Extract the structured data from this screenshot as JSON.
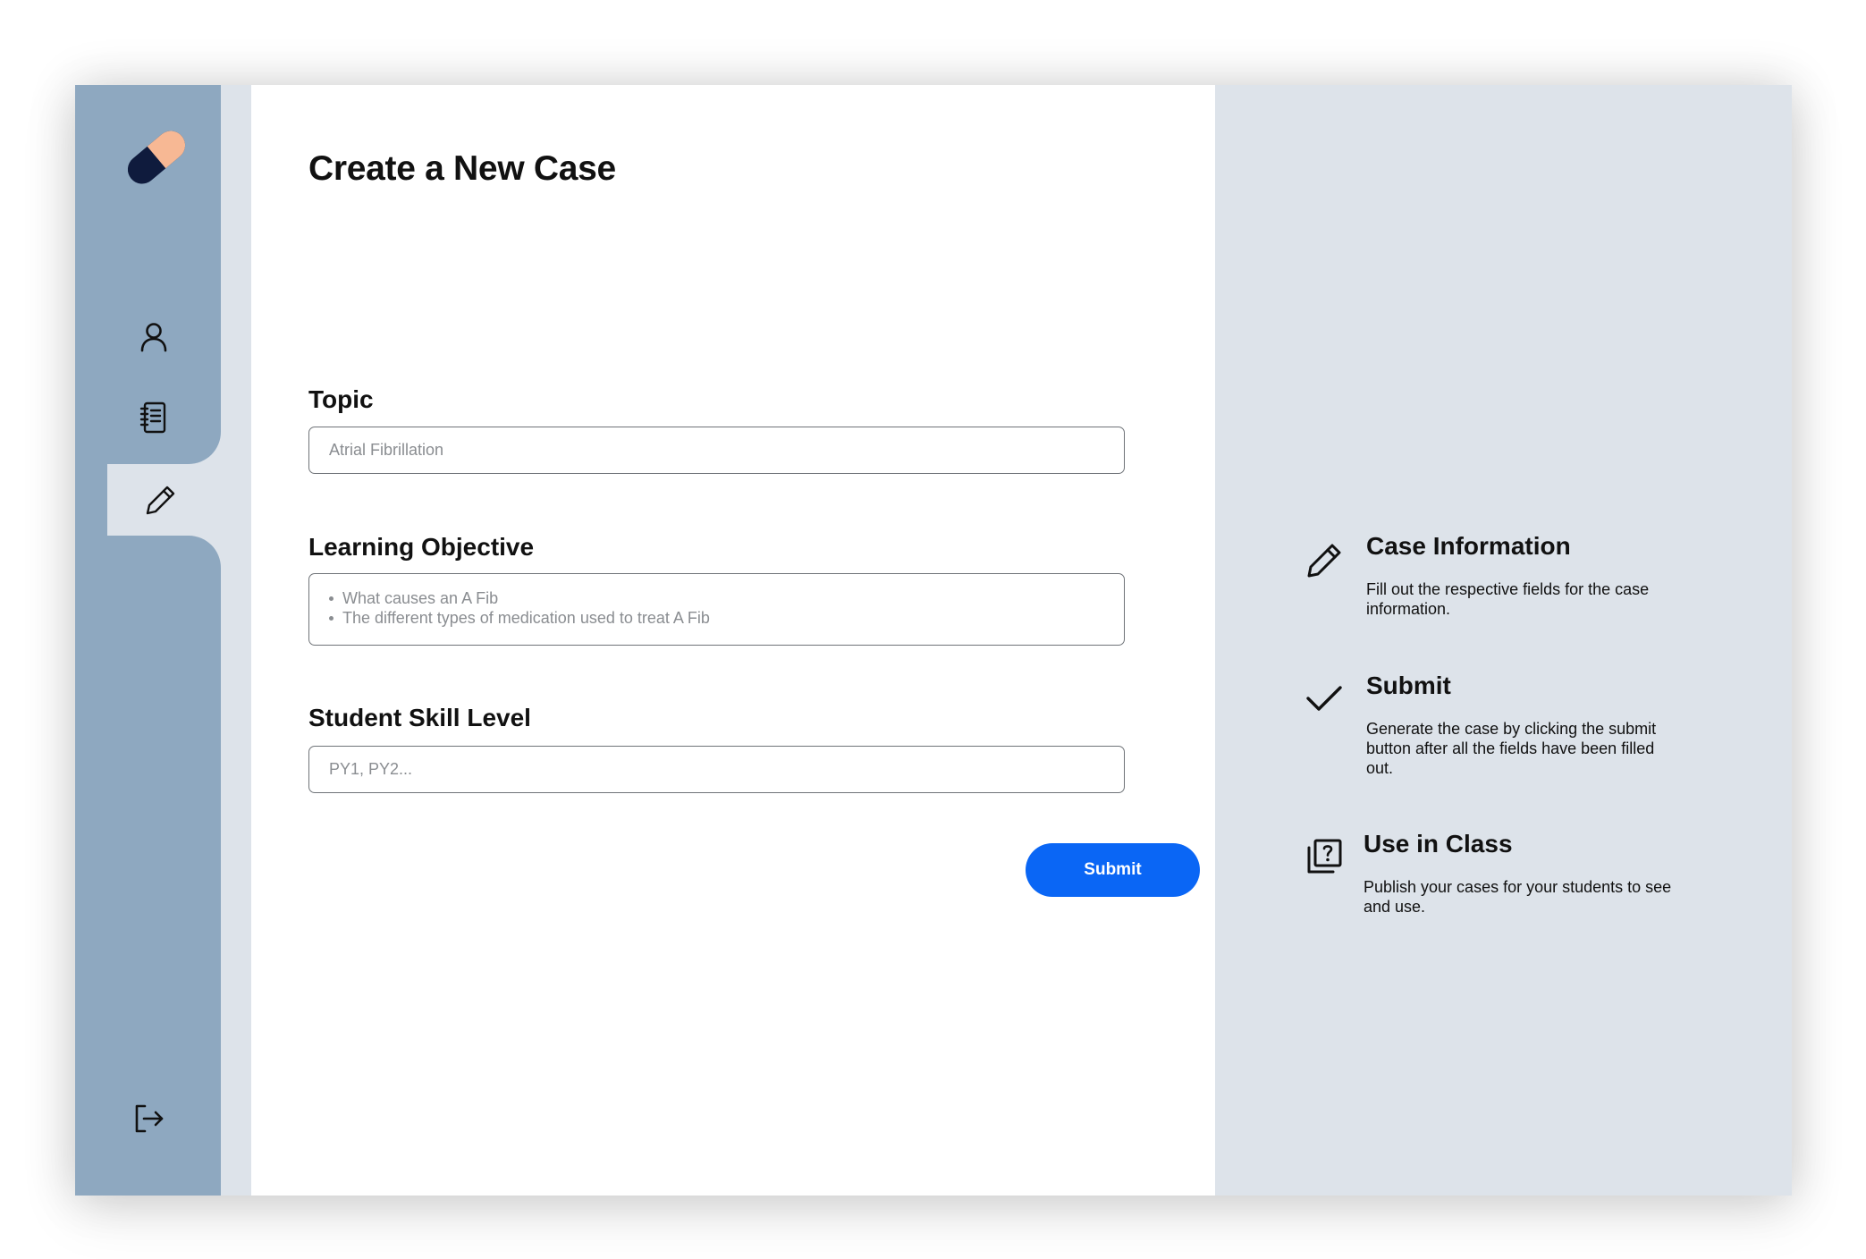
{
  "app": {
    "brand_colors": {
      "sidebar": "#8ea8c0",
      "panel": "#dde3ea",
      "accent": "#0a66f5",
      "logo_peach": "#f7b894",
      "logo_navy": "#0f1b3d"
    }
  },
  "sidebar": {
    "logo_icon": "pill-logo-icon",
    "items": [
      {
        "icon": "user-icon",
        "active": false
      },
      {
        "icon": "notebook-icon",
        "active": false
      },
      {
        "icon": "pencil-icon",
        "active": true
      }
    ],
    "logout_icon": "logout-icon"
  },
  "main": {
    "title": "Create a New Case",
    "fields": {
      "topic": {
        "label": "Topic",
        "placeholder": "Atrial Fibrillation"
      },
      "objective": {
        "label": "Learning Objective",
        "placeholder_items": [
          "What causes an A Fib",
          "The different types of medication used to treat A Fib"
        ]
      },
      "skill": {
        "label": "Student Skill Level",
        "placeholder": "PY1, PY2..."
      }
    },
    "submit_label": "Submit"
  },
  "info": {
    "items": [
      {
        "icon": "pencil-icon",
        "title": "Case Information",
        "description": "Fill out the respective fields for the case information."
      },
      {
        "icon": "checkmark-icon",
        "title": "Submit",
        "description": "Generate the case by clicking the submit button after all the fields have been filled out."
      },
      {
        "icon": "question-stack-icon",
        "title": "Use in Class",
        "description": "Publish your cases for your students to see and use."
      }
    ]
  }
}
